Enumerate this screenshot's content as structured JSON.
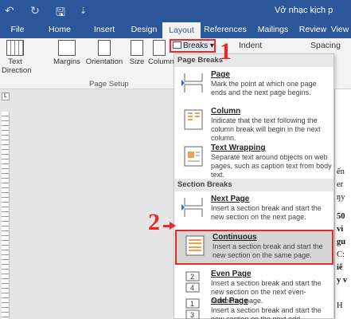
{
  "window": {
    "title": "Vở nhạc kịch p",
    "quick_access": [
      "↶",
      "↻",
      "🖫",
      "⇣"
    ]
  },
  "tabs": [
    "File",
    "Home",
    "Insert",
    "Design",
    "Layout",
    "References",
    "Mailings",
    "Review",
    "View"
  ],
  "active_tab": "Layout",
  "ribbon": {
    "text_direction": "Text Direction",
    "margins": "Margins",
    "orientation": "Orientation",
    "size": "Size",
    "columns": "Columns",
    "breaks": "Breaks",
    "indent": "Indent",
    "spacing": "Spacing",
    "group_label": "Page Setup",
    "ruler_corner": "L"
  },
  "menu": {
    "page_breaks_header": "Page Breaks",
    "section_breaks_header": "Section Breaks",
    "items": [
      {
        "title": "Page",
        "desc": "Mark the point at which one page ends and the next page begins."
      },
      {
        "title": "Column",
        "desc": "Indicate that the text following the column break will begin in the next column."
      },
      {
        "title": "Text Wrapping",
        "desc": "Separate text around objects on web pages, such as caption text from body text."
      },
      {
        "title": "Next Page",
        "desc": "Insert a section break and start the new section on the next page."
      },
      {
        "title": "Continuous",
        "desc": "Insert a section break and start the new section on the same page."
      },
      {
        "title": "Even Page",
        "desc": "Insert a section break and start the new section on the next even-numbered page."
      },
      {
        "title": "Odd Page",
        "desc": "Insert a section break and start the new section on the next odd-numbered page."
      }
    ],
    "icon_labels": {
      "even": "2",
      "even2": "4",
      "odd": "1",
      "odd2": "3"
    }
  },
  "callouts": {
    "one": "1",
    "two": "2"
  },
  "doc_fragments": [
    "ến",
    "er",
    "ŋy",
    "50",
    "vi",
    "gu",
    "C:",
    "iê",
    "y v",
    "H"
  ],
  "colors": {
    "brand": "#2b579a",
    "highlight": "#e32b2b"
  }
}
